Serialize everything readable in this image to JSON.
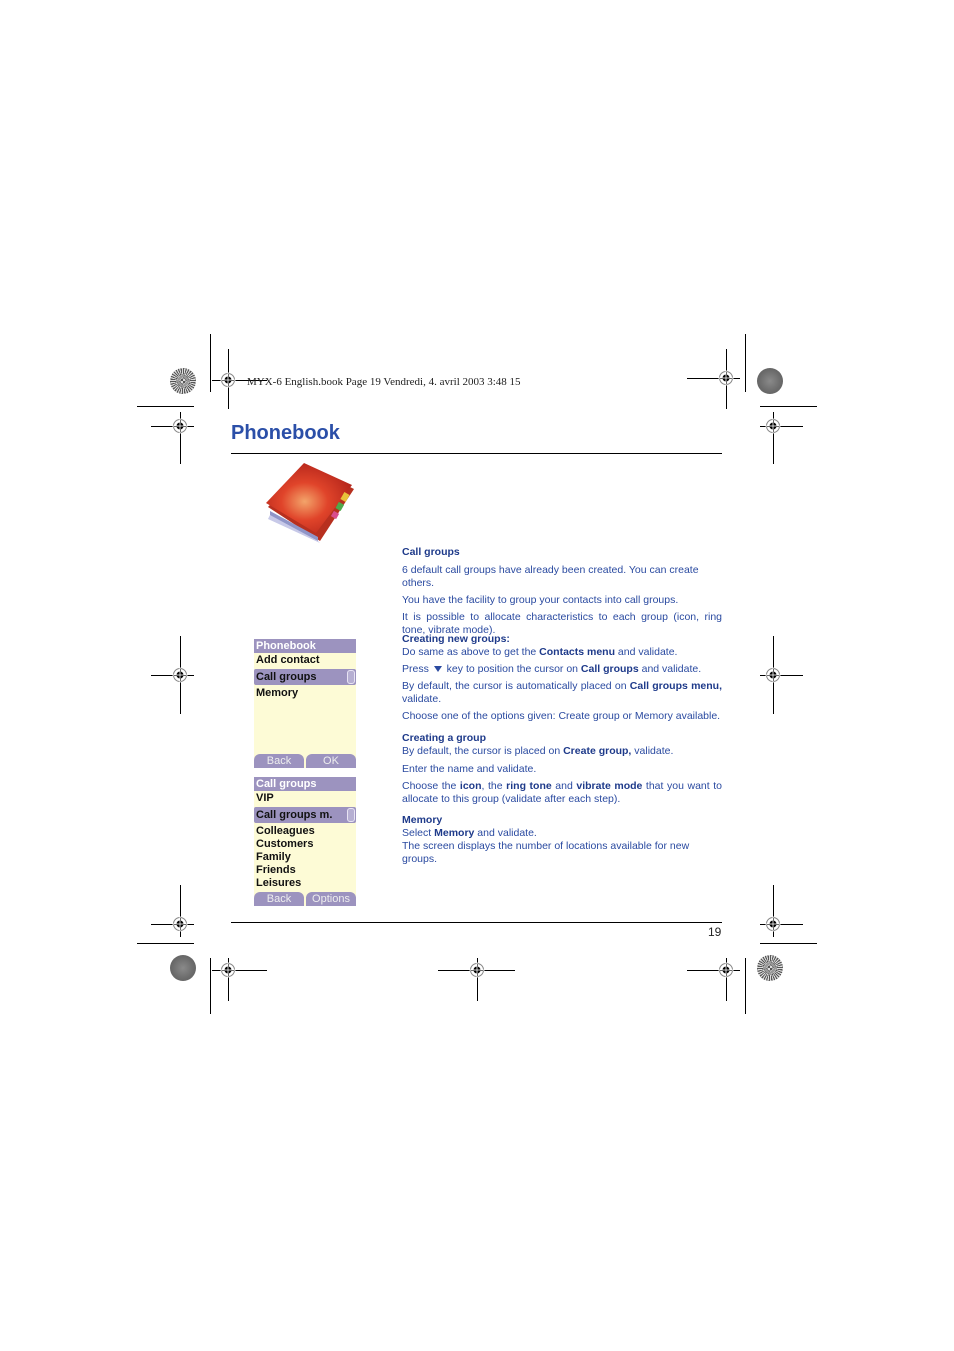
{
  "book_header": "MYX-6 English.book  Page 19  Vendredi, 4. avril 2003  3:48 15",
  "page_title": "Phonebook",
  "page_number": "19",
  "screen1": {
    "title": "Phonebook",
    "items": [
      "Add contact",
      "Call groups",
      "Memory"
    ],
    "selected_index": 1,
    "softkeys": [
      "Back",
      "OK"
    ]
  },
  "screen2": {
    "title": "Call groups",
    "items": [
      "VIP",
      "Call groups m.",
      "Colleagues",
      "Customers",
      "Family",
      "Friends",
      "Leisures"
    ],
    "selected_index": 1,
    "softkeys": [
      "Back",
      "Options"
    ]
  },
  "sections": {
    "call_groups": {
      "heading": "Call groups",
      "p1": "6 default call groups have already been created. You can create others.",
      "p2": "You have the facility to group your contacts into call groups.",
      "p3": "It is possible to allocate characteristics to each group (icon, ring tone, vibrate mode)."
    },
    "creating_new_groups": {
      "heading": "Creating new groups:",
      "l1_pre": "Do same as above to get the ",
      "l1_bold": "Contacts menu",
      "l1_post": " and validate.",
      "l2_pre": "Press",
      "l2_mid": " key to position the cursor on ",
      "l2_bold": "Call groups",
      "l2_post": " and validate.",
      "l3_pre": "By default, the cursor is automatically placed on ",
      "l3_bold": "Call groups menu,",
      "l3_post": " validate.",
      "l4": "Choose one of the options given: Create group or Memory available."
    },
    "creating_a_group": {
      "heading": "Creating a group",
      "l1_pre": "By default, the cursor is placed on ",
      "l1_bold": "Create group,",
      "l1_post": " validate.",
      "l2": "Enter the name and validate.",
      "l3_a": "Choose the ",
      "l3_b": "icon",
      "l3_c": ", the ",
      "l3_d": "ring tone",
      "l3_e": " and ",
      "l3_f": "vibrate mode",
      "l3_g": " that you want to allocate to this group (validate after each step)."
    },
    "memory": {
      "heading": "Memory",
      "l1_pre": "Select ",
      "l1_bold": "Memory",
      "l1_post": " and validate.",
      "l2": "The screen displays the number of locations available for new groups."
    }
  },
  "colors": {
    "title_blue": "#2b4fa8",
    "body_blue": "#2a4aa0",
    "screen_bg": "#fdfbd6",
    "screen_bar": "#9c93bf"
  }
}
